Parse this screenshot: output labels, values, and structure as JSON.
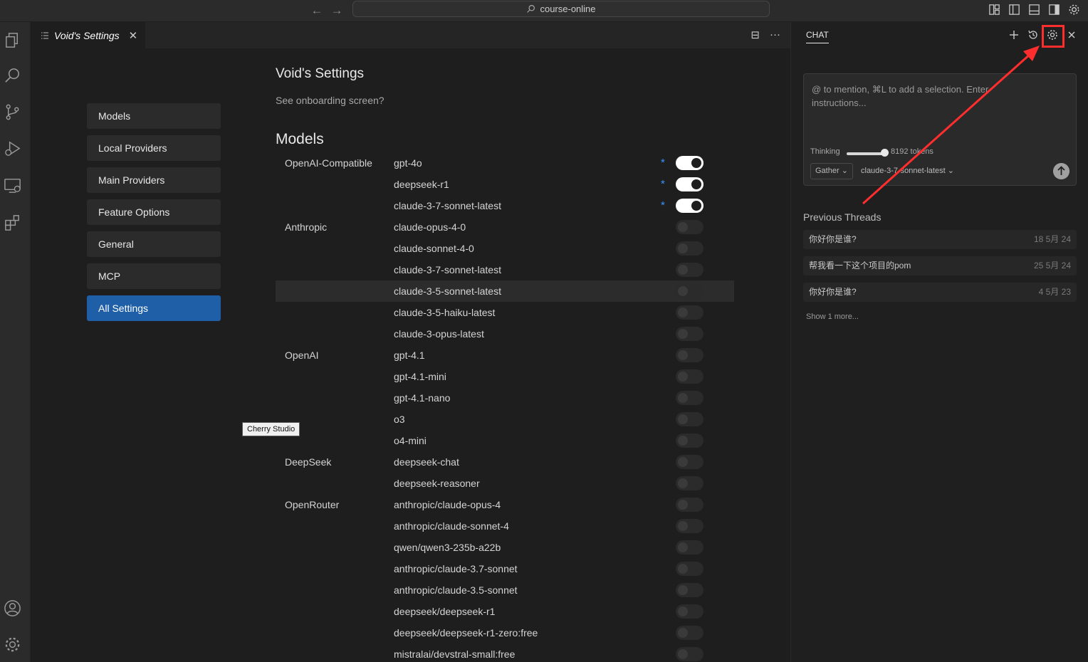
{
  "titlebar": {
    "command_center": "course-online",
    "back_icon": "arrow-left-icon",
    "forward_icon": "arrow-right-icon"
  },
  "tab": {
    "label": "Void's Settings",
    "close": "✕"
  },
  "tab_actions": {
    "split": "⊟",
    "more": "···"
  },
  "sidebar_nav": [
    {
      "label": "Models",
      "active": false
    },
    {
      "label": "Local Providers",
      "active": false
    },
    {
      "label": "Main Providers",
      "active": false
    },
    {
      "label": "Feature Options",
      "active": false
    },
    {
      "label": "General",
      "active": false
    },
    {
      "label": "MCP",
      "active": false
    },
    {
      "label": "All Settings",
      "active": true
    }
  ],
  "settings": {
    "title": "Void's Settings",
    "onboarding": "See onboarding screen?",
    "models_heading": "Models"
  },
  "models": [
    {
      "provider": "OpenAI-Compatible",
      "name": "gpt-4o",
      "enabled": true,
      "custom": true
    },
    {
      "provider": "",
      "name": "deepseek-r1",
      "enabled": true,
      "custom": true
    },
    {
      "provider": "",
      "name": "claude-3-7-sonnet-latest",
      "enabled": true,
      "custom": true
    },
    {
      "provider": "Anthropic",
      "name": "claude-opus-4-0",
      "enabled": false,
      "custom": false
    },
    {
      "provider": "",
      "name": "claude-sonnet-4-0",
      "enabled": false,
      "custom": false
    },
    {
      "provider": "",
      "name": "claude-3-7-sonnet-latest",
      "enabled": false,
      "custom": false
    },
    {
      "provider": "",
      "name": "claude-3-5-sonnet-latest",
      "enabled": false,
      "custom": false,
      "hovered": true
    },
    {
      "provider": "",
      "name": "claude-3-5-haiku-latest",
      "enabled": false,
      "custom": false
    },
    {
      "provider": "",
      "name": "claude-3-opus-latest",
      "enabled": false,
      "custom": false
    },
    {
      "provider": "OpenAI",
      "name": "gpt-4.1",
      "enabled": false,
      "custom": false
    },
    {
      "provider": "",
      "name": "gpt-4.1-mini",
      "enabled": false,
      "custom": false
    },
    {
      "provider": "",
      "name": "gpt-4.1-nano",
      "enabled": false,
      "custom": false
    },
    {
      "provider": "",
      "name": "o3",
      "enabled": false,
      "custom": false
    },
    {
      "provider": "",
      "name": "o4-mini",
      "enabled": false,
      "custom": false
    },
    {
      "provider": "DeepSeek",
      "name": "deepseek-chat",
      "enabled": false,
      "custom": false
    },
    {
      "provider": "",
      "name": "deepseek-reasoner",
      "enabled": false,
      "custom": false
    },
    {
      "provider": "OpenRouter",
      "name": "anthropic/claude-opus-4",
      "enabled": false,
      "custom": false
    },
    {
      "provider": "",
      "name": "anthropic/claude-sonnet-4",
      "enabled": false,
      "custom": false
    },
    {
      "provider": "",
      "name": "qwen/qwen3-235b-a22b",
      "enabled": false,
      "custom": false
    },
    {
      "provider": "",
      "name": "anthropic/claude-3.7-sonnet",
      "enabled": false,
      "custom": false
    },
    {
      "provider": "",
      "name": "anthropic/claude-3.5-sonnet",
      "enabled": false,
      "custom": false
    },
    {
      "provider": "",
      "name": "deepseek/deepseek-r1",
      "enabled": false,
      "custom": false
    },
    {
      "provider": "",
      "name": "deepseek/deepseek-r1-zero:free",
      "enabled": false,
      "custom": false
    },
    {
      "provider": "",
      "name": "mistralai/devstral-small:free",
      "enabled": false,
      "custom": false
    }
  ],
  "star_glyph": "*",
  "tooltip": "Cherry Studio",
  "chat": {
    "tab_label": "CHAT",
    "placeholder": "@ to mention, ⌘L to add a selection. Enter instructions...",
    "thinking_label": "Thinking",
    "thinking_level": 1.0,
    "tokens": "8192 tokens",
    "mode": "Gather",
    "model": "claude-3-7-sonnet-latest",
    "previous_threads_title": "Previous Threads",
    "threads": [
      {
        "title": "你好你是谁?",
        "date": "18 5月 24"
      },
      {
        "title": "帮我看一下这个项目的pom",
        "date": "25 5月 24"
      },
      {
        "title": "你好你是谁?",
        "date": "4 5月 23"
      }
    ],
    "show_more": "Show 1 more..."
  },
  "colors": {
    "accent": "#1f5fa8",
    "star": "#3794ff",
    "annotation": "#ff2e2e"
  }
}
